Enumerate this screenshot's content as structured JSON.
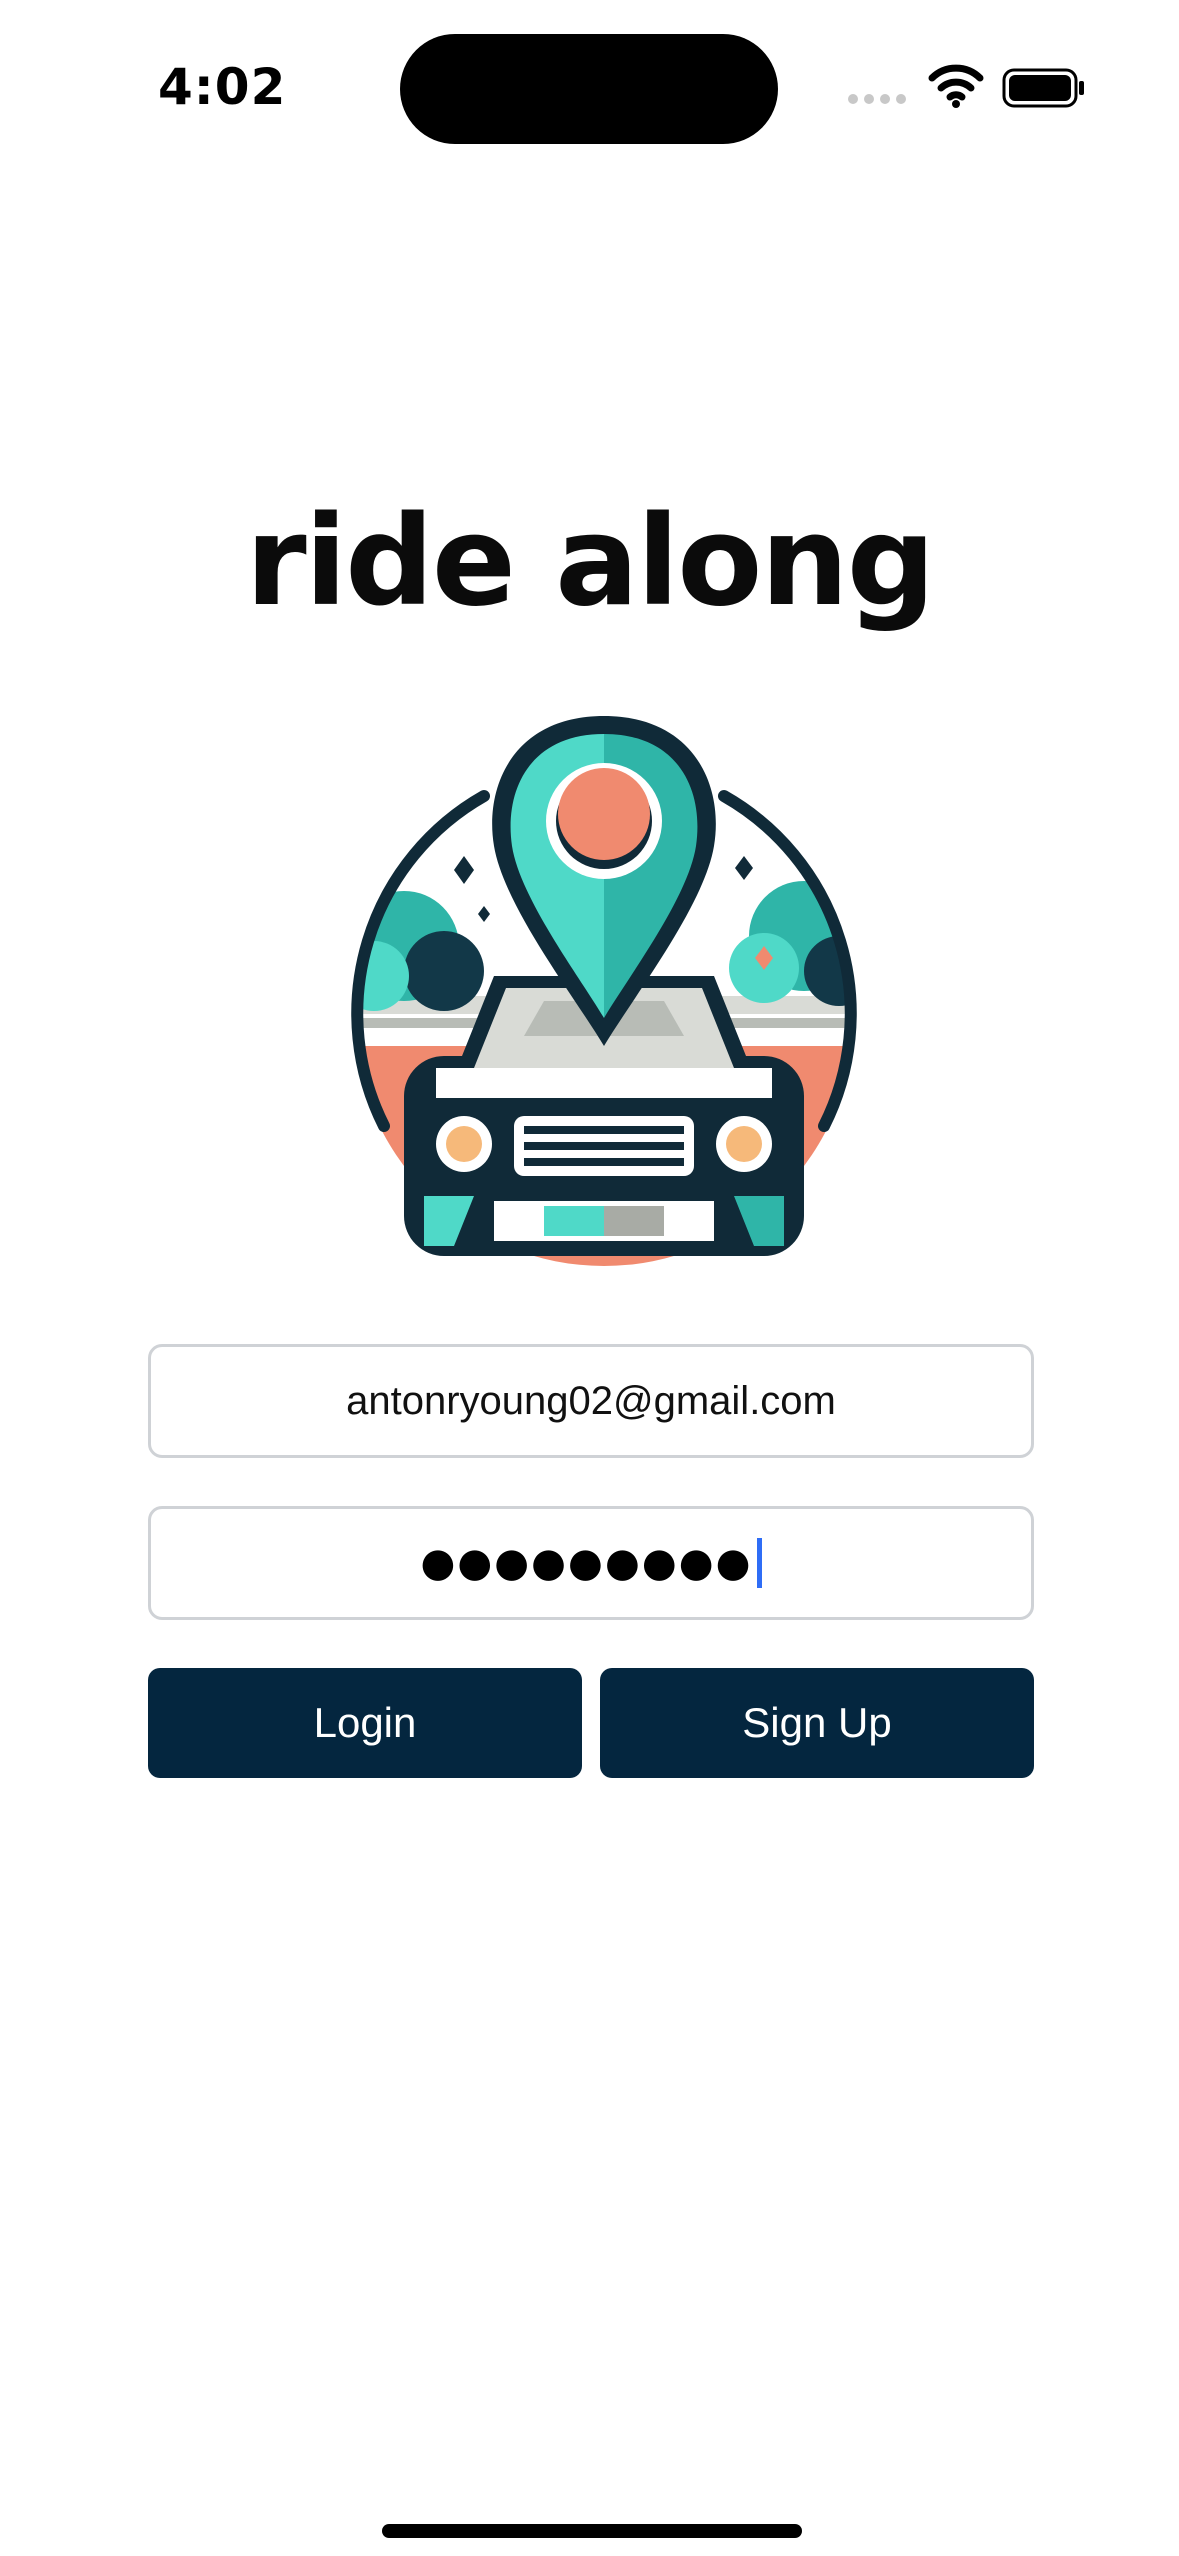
{
  "status_bar": {
    "time": "4:02"
  },
  "app": {
    "title": "ride along"
  },
  "form": {
    "email_value": "antonryoung02@gmail.com",
    "password_masked": "●●●●●●●●●"
  },
  "buttons": {
    "login_label": "Login",
    "signup_label": "Sign Up"
  },
  "colors": {
    "button_bg": "#04263f",
    "accent_teal": "#4fd9c8",
    "accent_coral": "#f08a6f",
    "caret": "#2f6df6"
  },
  "icons": {
    "logo": "car-with-location-pin-logo"
  }
}
